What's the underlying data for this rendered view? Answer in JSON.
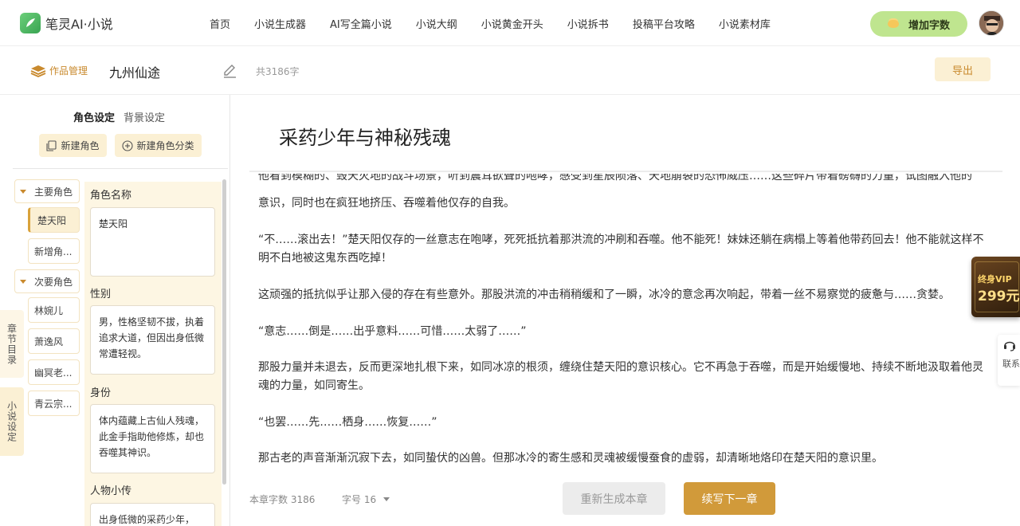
{
  "app": {
    "logo_text": "笔灵AI·小说"
  },
  "nav": {
    "items": [
      "首页",
      "小说生成器",
      "AI写全篇小说",
      "小说大纲",
      "小说黄金开头",
      "小说拆书",
      "投稿平台攻略",
      "小说素材库"
    ],
    "add_words": "增加字数"
  },
  "workbar": {
    "works_mgmt": "作品管理",
    "title": "九州仙途",
    "word_total": "共3186字",
    "export": "导出"
  },
  "panel": {
    "tabs": [
      "角色设定",
      "背景设定"
    ],
    "new_role": "新建角色",
    "new_category": "新建角色分类",
    "groups": [
      {
        "label": "主要角色",
        "roles": [
          "楚天阳",
          "新增角..."
        ]
      },
      {
        "label": "次要角色",
        "roles": [
          "林婉儿",
          "萧逸风",
          "幽冥老...",
          "青云宗..."
        ]
      }
    ],
    "side_tabs": [
      "章节目录",
      "小说设定"
    ],
    "fields": {
      "name_label": "角色名称",
      "name_value": "楚天阳",
      "gender_label": "性别",
      "gender_value": "男，性格坚韧不拔，执着追求大道，但因出身低微常遭轻视。",
      "identity_label": "身份",
      "identity_value": "体内蕴藏上古仙人残魂，此金手指助他修炼，却也吞噬其神识。",
      "bio_label": "人物小传",
      "bio_value": "出身低微的采药少年，"
    }
  },
  "chapter": {
    "title": "采药少年与神秘残魂",
    "cut_line": "他看到模糊的、毁天灭地的战斗场景，听到震耳欲聋的咆哮，感受到星辰陨落、天地崩裂的恐怖威压……这些碎片带着磅礴的力量，试图融入他的",
    "paragraphs": [
      "意识，同时也在疯狂地挤压、吞噬着他仅存的自我。",
      "“不……滚出去！”楚天阳仅存的一丝意志在咆哮，死死抵抗着那洪流的冲刷和吞噬。他不能死！妹妹还躺在病榻上等着他带药回去！他不能就这样不明不白地被这鬼东西吃掉！",
      "这顽强的抵抗似乎让那入侵的存在有些意外。那股洪流的冲击稍稍缓和了一瞬，冰冷的意念再次响起，带着一丝不易察觉的疲惫与……贪婪。",
      "“意志……倒是……出乎意料……可惜……太弱了……”",
      "那股力量并未退去，反而更深地扎根下来，如同冰凉的根须，缠绕住楚天阳的意识核心。它不再急于吞噬，而是开始缓慢地、持续不断地汲取着他灵魂的力量，如同寄生。",
      "“也罢……先……栖身……恢复……”",
      "那古老的声音渐渐沉寂下去，如同蛰伏的凶兽。但那冰冷的寄生感和灵魂被缓慢蚕食的虚弱，却清晰地烙印在楚天阳的意识里。"
    ],
    "chapter_words": "本章字数 3186",
    "font_size": "字号 16",
    "regen": "重新生成本章",
    "next": "续写下一章"
  },
  "floating": {
    "vip_line1": "终身VIP",
    "vip_line2": "299元",
    "contact": "联系客服"
  }
}
